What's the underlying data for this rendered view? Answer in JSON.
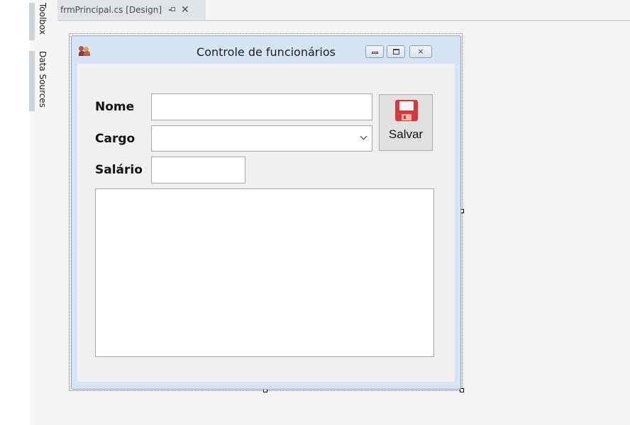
{
  "sidebar": {
    "tabs": [
      {
        "label": "Toolbox"
      },
      {
        "label": "Data Sources"
      }
    ]
  },
  "document_tab": {
    "title": "frmPrincipal.cs [Design]",
    "pin_icon": "pin-icon",
    "close_icon": "close-icon",
    "close_glyph": "✕"
  },
  "form": {
    "title": "Controle de funcionários",
    "app_icon": "users-icon",
    "caption_buttons": {
      "minimize_icon": "minimize-icon",
      "maximize_icon": "maximize-icon",
      "close_icon": "close-icon",
      "close_glyph": "⨯"
    },
    "fields": {
      "nome": {
        "label": "Nome",
        "value": ""
      },
      "cargo": {
        "label": "Cargo",
        "value": ""
      },
      "salario": {
        "label": "Salário",
        "value": ""
      }
    },
    "save_button": {
      "label": "Salvar",
      "icon": "floppy-disk-icon"
    },
    "list_items": []
  },
  "colors": {
    "form_border": "#8aa6c8",
    "form_frame": "#d6e4f4",
    "client_background": "#f0f0f0",
    "floppy_red": "#d9363e"
  }
}
